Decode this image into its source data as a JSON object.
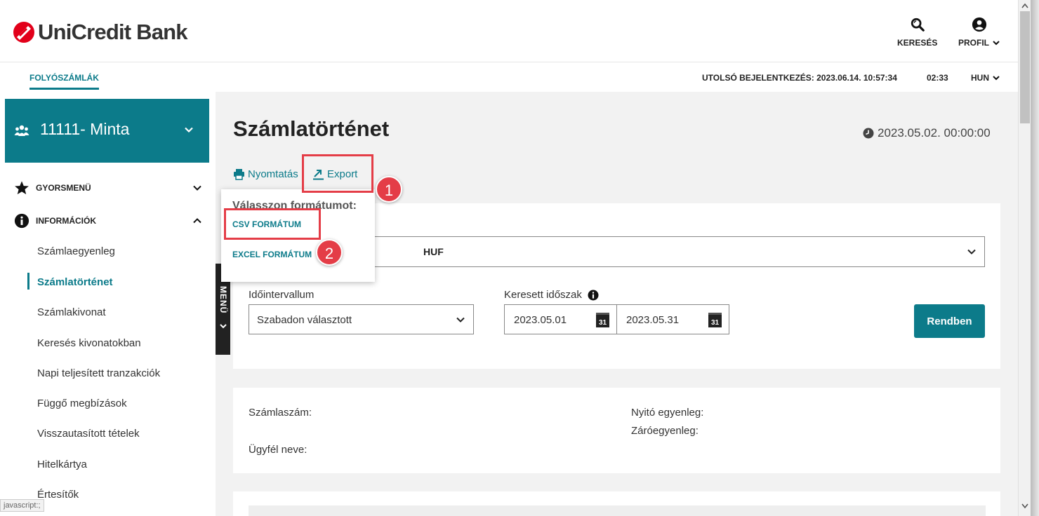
{
  "header": {
    "logo_text": "UniCredit Bank",
    "search_label": "KERESÉS",
    "profile_label": "PROFIL"
  },
  "subbar": {
    "tab_label": "FOLYÓSZÁMLÁK",
    "last_login": "UTOLSÓ BEJELENTKEZÉS: 2023.06.14. 10:57:34",
    "session_time": "02:33",
    "language": "HUN"
  },
  "sidebar": {
    "account_name": "11111- Minta",
    "quick_menu_label": "GYORSMENÜ",
    "info_label": "INFORMÁCIÓK",
    "items": [
      {
        "label": "Számlaegyenleg"
      },
      {
        "label": "Számlatörténet"
      },
      {
        "label": "Számlakivonat"
      },
      {
        "label": "Keresés kivonatokban"
      },
      {
        "label": "Napi teljesített tranzakciók"
      },
      {
        "label": "Függő megbízások"
      },
      {
        "label": "Visszautasított tételek"
      },
      {
        "label": "Hitelkártya"
      },
      {
        "label": "Értesítők"
      }
    ],
    "menu_toggle_label": "MENÜ",
    "status_tip": "javascript:;"
  },
  "main": {
    "page_title": "Számlatörténet",
    "timestamp": "2023.05.02. 00:00:00",
    "print_label": "Nyomtatás",
    "export_label": "Export",
    "account_select_value": "HUF",
    "interval_label": "Időintervallum",
    "interval_value": "Szabadon választott",
    "period_label": "Keresett időszak",
    "date_from": "2023.05.01",
    "date_to": "2023.05.31",
    "calendar_day": "31",
    "ok_button": "Rendben",
    "account_number_label": "Számlaszám:",
    "client_name_label": "Ügyfél neve:",
    "opening_balance_label": "Nyitó egyenleg:",
    "closing_balance_label": "Záróegyenleg:"
  },
  "export_dropdown": {
    "heading": "Válasszon formátumot:",
    "csv_label": "CSV FORMÁTUM",
    "excel_label": "EXCEL FORMÁTUM"
  },
  "annotations": {
    "step1": "1",
    "step2": "2"
  },
  "colors": {
    "brand_teal": "#0c7b8a",
    "brand_red": "#e2001a",
    "annotation_red": "#e43d47"
  }
}
